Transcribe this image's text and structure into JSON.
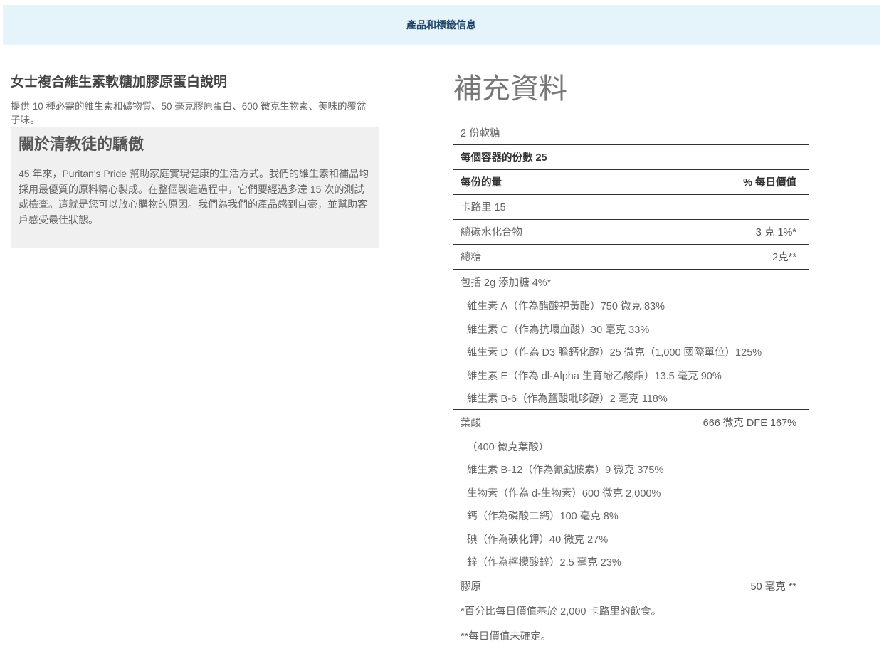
{
  "header": {
    "tab_label": "產品和標籤信息"
  },
  "product": {
    "title": "女士複合維生素軟糖加膠原蛋白說明",
    "description": "提供 10 種必需的維生素和礦物質、50 毫克膠原蛋白、600 微克生物素、美味的覆盆子味。"
  },
  "about": {
    "title": "關於清教徒的驕傲",
    "text": "45 年來，Puritan's Pride 幫助家庭實現健康的生活方式。我們的維生素和補品均採用最優質的原料精心製成。在整個製造過程中，它們要經過多達 15 次的測試或檢查。這就是您可以放心購物的原因。我們為我們的產品感到自豪，並幫助客戶感受最佳狀態。"
  },
  "supplement_facts": {
    "title": "補充資料",
    "serving_size": "2 份軟糖",
    "servings_per_container": "每個容器的份數 25",
    "amount_per_serving": "每份的量",
    "daily_value_header": "% 每日價值",
    "calories": "卡路里 15",
    "rows": {
      "carbs_label": "總碳水化合物",
      "carbs_value": "3 克 1%*",
      "sugars_label": "總糖",
      "sugars_value": "2克**",
      "added_sugars": "包括 2g 添加糖 4%*",
      "vitamin_a": "維生素 A（作為醋酸視黃酯）750 微克 83%",
      "vitamin_c": "維生素 C（作為抗壞血酸）30 毫克 33%",
      "vitamin_d": "維生素 D（作為 D3 膽鈣化醇）25 微克（1,000 國際單位）125%",
      "vitamin_e": "維生素 E（作為 dl-Alpha 生育酚乙酸酯）13.5 毫克 90%",
      "vitamin_b6": "維生素 B-6（作為鹽酸吡哆醇）2 毫克 118%",
      "folate_label": "葉酸",
      "folate_value": "666 微克 DFE 167%",
      "folic_acid": "（400 微克葉酸）",
      "vitamin_b12": "維生素 B-12（作為氰鈷胺素）9 微克 375%",
      "biotin": "生物素（作為 d-生物素）600 微克 2,000%",
      "calcium": "鈣（作為磷酸二鈣）100 毫克 8%",
      "iodine": "碘（作為碘化鉀）40 微克 27%",
      "zinc": "鋅（作為檸檬酸鋅）2.5 毫克 23%",
      "collagen_label": "膠原",
      "collagen_value": "50 毫克 **"
    },
    "footnote_1": "*百分比每日價值基於 2,000 卡路里的飲食。",
    "footnote_2": "**每日價值未確定。"
  }
}
